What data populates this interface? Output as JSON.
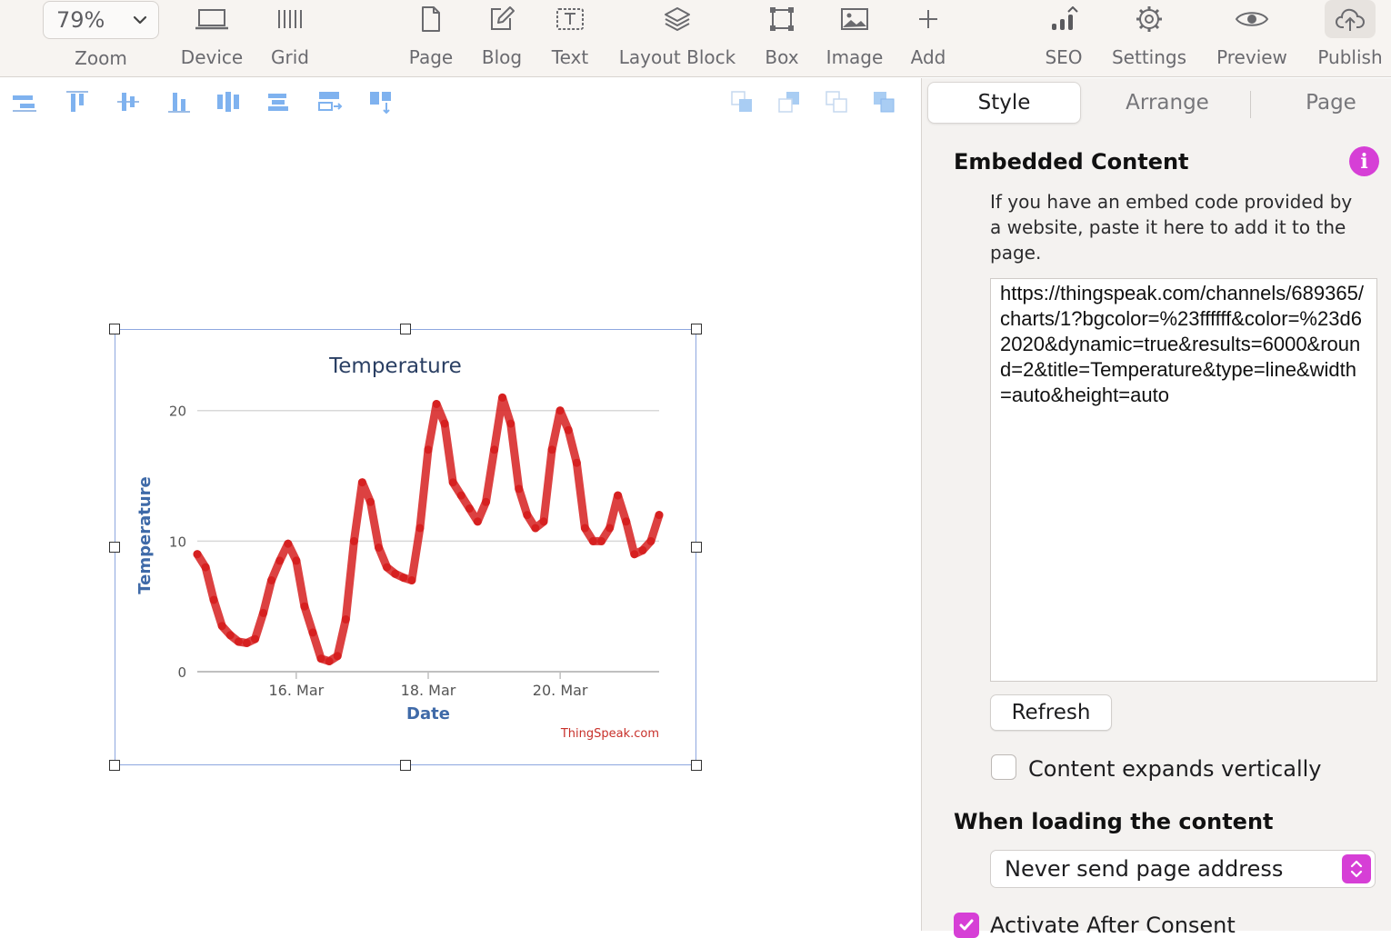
{
  "toolbar": {
    "zoom": {
      "value": "79%",
      "label": "Zoom"
    },
    "items": [
      {
        "label": "Device",
        "icon": "laptop-icon"
      },
      {
        "label": "Grid",
        "icon": "grid-icon"
      },
      {
        "label": "Page",
        "icon": "page-icon"
      },
      {
        "label": "Blog",
        "icon": "blog-edit-icon"
      },
      {
        "label": "Text",
        "icon": "text-box-icon"
      },
      {
        "label": "Layout Block",
        "icon": "layers-icon"
      },
      {
        "label": "Box",
        "icon": "box-icon"
      },
      {
        "label": "Image",
        "icon": "image-icon"
      },
      {
        "label": "Add",
        "icon": "plus-icon"
      },
      {
        "label": "SEO",
        "icon": "seo-bars-icon"
      },
      {
        "label": "Settings",
        "icon": "gear-icon"
      },
      {
        "label": "Preview",
        "icon": "eye-icon"
      },
      {
        "label": "Publish",
        "icon": "cloud-upload-icon"
      }
    ]
  },
  "inspector": {
    "tabs": [
      "Style",
      "Arrange",
      "Page"
    ],
    "active_tab": "Style",
    "section_title": "Embedded Content",
    "description": "If you have an embed code provided by a website, paste it here to add it to the page.",
    "embed_code": "https://thingspeak.com/channels/689365/charts/1?bgcolor=%23ffffff&color=%23d62020&dynamic=true&results=6000&round=2&title=Temperature&type=line&width=auto&height=auto",
    "refresh_label": "Refresh",
    "expands_label": "Content expands vertically",
    "expands_checked": false,
    "loading_title": "When loading the content",
    "loading_select": "Never send page address",
    "consent_label": "Activate After Consent",
    "consent_checked": true,
    "accent_color": "#d63fd6"
  },
  "chart_data": {
    "type": "line",
    "title": "Temperature",
    "xlabel": "Date",
    "ylabel": "Temperature",
    "x_tick_labels": [
      "16. Mar",
      "18. Mar",
      "20. Mar"
    ],
    "y_ticks": [
      0,
      10,
      20
    ],
    "ylim": [
      0,
      22
    ],
    "xlim": [
      "2019-03-14 12:00",
      "2019-03-21 12:00"
    ],
    "grid": true,
    "credit": "ThingSpeak.com",
    "line_color": "#d62020",
    "series": [
      {
        "x": [
          "2019-03-14 12:00",
          "2019-03-14 15:00",
          "2019-03-14 18:00",
          "2019-03-14 21:00",
          "2019-03-15 00:00",
          "2019-03-15 03:00",
          "2019-03-15 06:00",
          "2019-03-15 09:00",
          "2019-03-15 12:00",
          "2019-03-15 15:00",
          "2019-03-15 18:00",
          "2019-03-15 21:00",
          "2019-03-16 00:00",
          "2019-03-16 03:00",
          "2019-03-16 06:00",
          "2019-03-16 09:00",
          "2019-03-16 12:00",
          "2019-03-16 15:00",
          "2019-03-16 18:00",
          "2019-03-16 21:00",
          "2019-03-17 00:00",
          "2019-03-17 03:00",
          "2019-03-17 06:00",
          "2019-03-17 09:00",
          "2019-03-17 12:00",
          "2019-03-17 15:00",
          "2019-03-17 18:00",
          "2019-03-17 21:00",
          "2019-03-18 00:00",
          "2019-03-18 03:00",
          "2019-03-18 06:00",
          "2019-03-18 09:00",
          "2019-03-18 12:00",
          "2019-03-18 15:00",
          "2019-03-18 18:00",
          "2019-03-18 21:00",
          "2019-03-19 00:00",
          "2019-03-19 03:00",
          "2019-03-19 06:00",
          "2019-03-19 09:00",
          "2019-03-19 12:00",
          "2019-03-19 15:00",
          "2019-03-19 18:00",
          "2019-03-19 21:00",
          "2019-03-20 00:00",
          "2019-03-20 03:00",
          "2019-03-20 06:00",
          "2019-03-20 09:00",
          "2019-03-20 12:00",
          "2019-03-20 15:00",
          "2019-03-20 18:00",
          "2019-03-20 21:00",
          "2019-03-21 00:00",
          "2019-03-21 03:00",
          "2019-03-21 06:00",
          "2019-03-21 09:00",
          "2019-03-21 12:00"
        ],
        "y": [
          9.0,
          8.0,
          5.5,
          3.5,
          2.8,
          2.3,
          2.2,
          2.5,
          4.5,
          7.0,
          8.5,
          9.8,
          8.5,
          5.0,
          3.0,
          1.0,
          0.8,
          1.2,
          4.0,
          10.0,
          14.5,
          13.0,
          9.5,
          8.0,
          7.5,
          7.2,
          7.0,
          11.0,
          17.0,
          20.5,
          19.0,
          14.5,
          13.5,
          12.5,
          11.5,
          13.0,
          17.0,
          21.0,
          19.0,
          14.0,
          12.0,
          11.0,
          11.5,
          17.0,
          20.0,
          18.5,
          16.0,
          11.0,
          10.0,
          10.0,
          11.0,
          13.5,
          11.5,
          9.0,
          9.3,
          10.0,
          12.0
        ]
      }
    ]
  }
}
